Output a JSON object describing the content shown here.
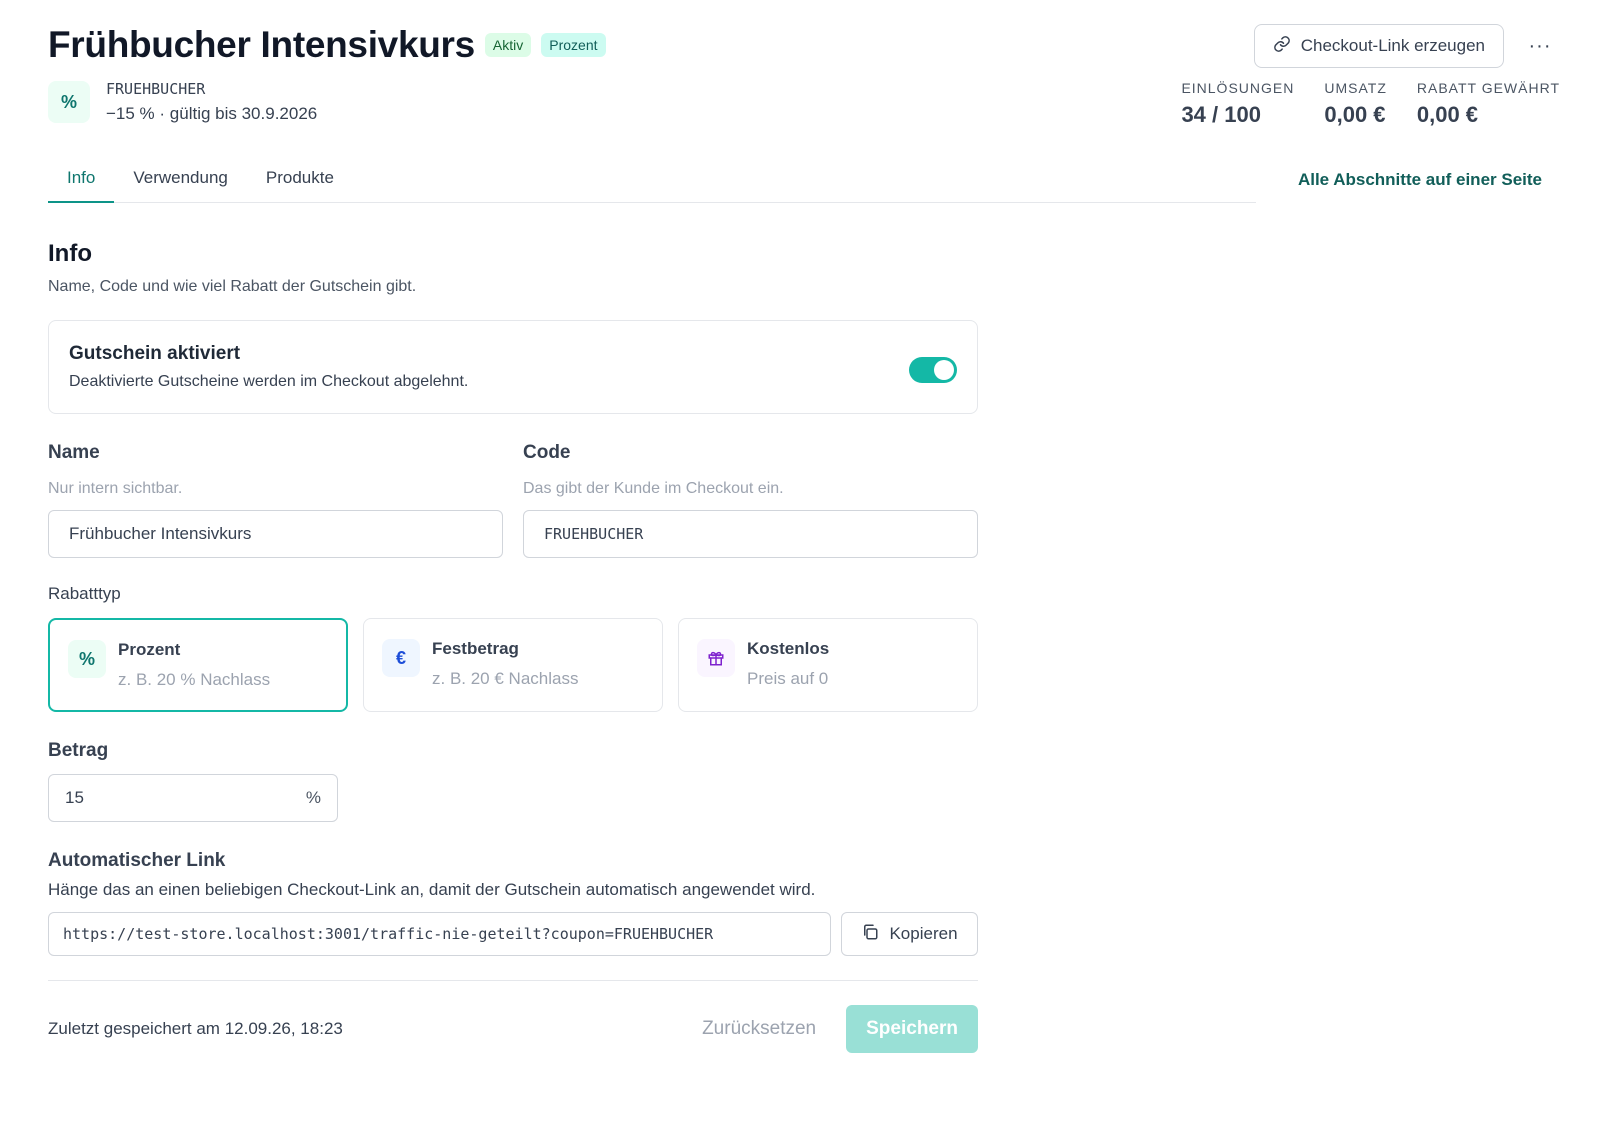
{
  "header": {
    "title": "Frühbucher Intensivkurs",
    "badges": [
      "Aktiv",
      "Prozent"
    ],
    "code_icon": "percent-icon",
    "code": "FRUEHBUCHER",
    "code_summary": "−15 % · gültig bis 30.9.2026",
    "checkout_link_label": "Checkout-Link erzeugen",
    "more_label": "···"
  },
  "stats": [
    {
      "label": "EINLÖSUNGEN",
      "value": "34 / 100"
    },
    {
      "label": "UMSATZ",
      "value": "0,00 €"
    },
    {
      "label": "RABATT GEWÄHRT",
      "value": "0,00 €"
    }
  ],
  "tabs": [
    {
      "label": "Info",
      "active": true
    },
    {
      "label": "Verwendung",
      "active": false
    },
    {
      "label": "Produkte",
      "active": false
    }
  ],
  "all_sections_link": "Alle Abschnitte auf einer Seite",
  "section": {
    "title": "Info",
    "subtitle": "Name, Code und wie viel Rabatt der Gutschein gibt."
  },
  "activation": {
    "title": "Gutschein aktiviert",
    "subtitle": "Deaktivierte Gutscheine werden im Checkout abgelehnt.",
    "enabled": true
  },
  "fields": {
    "name": {
      "label": "Name",
      "hint": "Nur intern sichtbar.",
      "value": "Frühbucher Intensivkurs"
    },
    "code": {
      "label": "Code",
      "hint": "Das gibt der Kunde im Checkout ein.",
      "value": "FRUEHBUCHER"
    }
  },
  "discount_type": {
    "label": "Rabatttyp",
    "options": [
      {
        "icon": "percent-icon",
        "glyph": "%",
        "title": "Prozent",
        "subtitle": "z. B. 20 % Nachlass",
        "selected": true
      },
      {
        "icon": "euro-icon",
        "glyph": "€",
        "title": "Festbetrag",
        "subtitle": "z. B. 20 € Nachlass",
        "selected": false
      },
      {
        "icon": "gift-icon",
        "glyph": "🎁",
        "title": "Kostenlos",
        "subtitle": "Preis auf 0",
        "selected": false
      }
    ]
  },
  "amount": {
    "label": "Betrag",
    "value": "15",
    "unit": "%"
  },
  "autolink": {
    "label": "Automatischer Link",
    "subtitle": "Hänge das an einen beliebigen Checkout-Link an, damit der Gutschein automatisch angewendet wird.",
    "url": "https://test-store.localhost:3001/traffic-nie-geteilt?coupon=FRUEHBUCHER",
    "copy_label": "Kopieren"
  },
  "footer": {
    "last_saved": "Zuletzt gespeichert am 12.09.26, 18:23",
    "reset_label": "Zurücksetzen",
    "save_label": "Speichern"
  },
  "colors": {
    "accent": "#14b8a6",
    "accent_dark": "#115e59",
    "save_disabled": "#99e0d6"
  }
}
